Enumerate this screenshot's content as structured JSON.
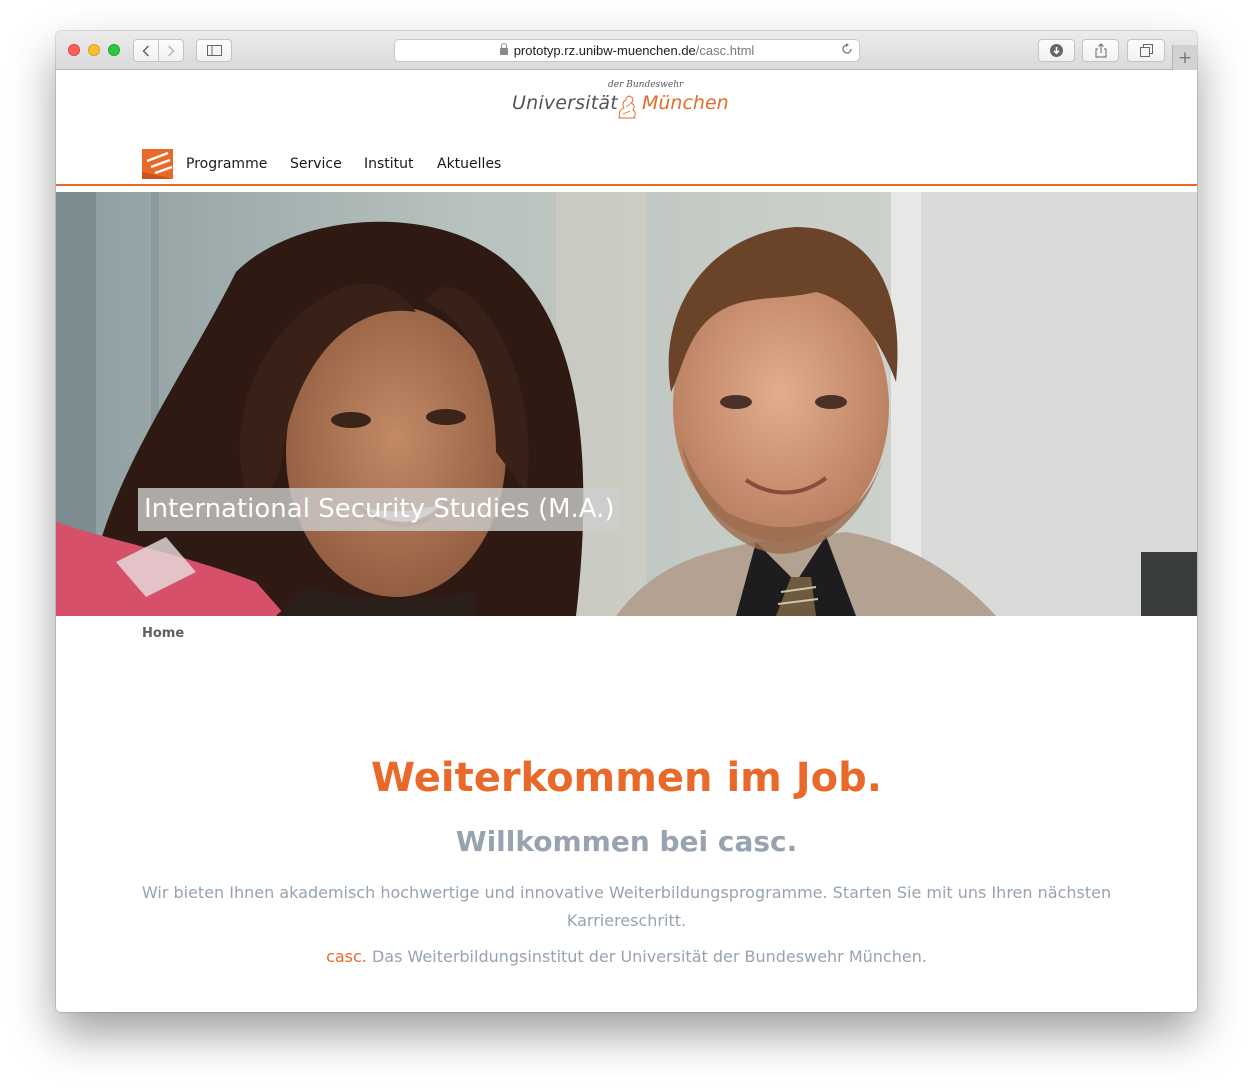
{
  "browser": {
    "url_host": "prototyp.rz.unibw-muenchen.de",
    "url_path": "/casc.html"
  },
  "logo": {
    "small": "der Bundeswehr",
    "left": "Universität",
    "right": "München"
  },
  "nav": {
    "items": [
      "Programme",
      "Service",
      "Institut",
      "Aktuelles"
    ]
  },
  "hero": {
    "caption": "International Security Studies (M.A.)"
  },
  "breadcrumb": {
    "home": "Home"
  },
  "main": {
    "headline": "Weiterkommen im Job.",
    "subheadline": "Willkommen bei casc.",
    "lead": "Wir bieten Ihnen akademisch hochwertige und innovative Weiterbildungsprogramme. Starten Sie mit uns Ihren nächsten Karriereschritt.",
    "tagline_brand": "casc.",
    "tagline_text": " Das Weiterbildungsinstitut der Universität der Bundeswehr München."
  },
  "colors": {
    "accent": "#e8692a",
    "muted_text": "#97a3b0"
  }
}
